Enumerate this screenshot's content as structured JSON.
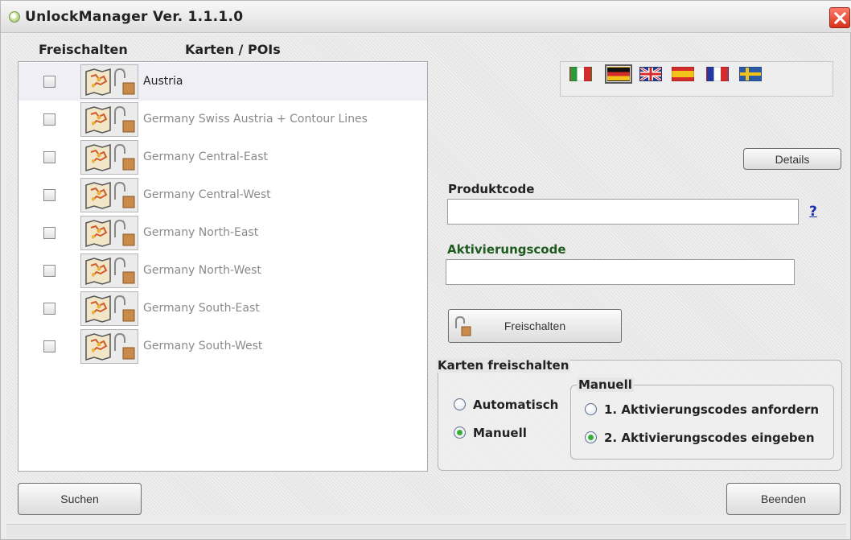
{
  "window": {
    "title": "UnlockManager Ver. 1.1.1.0"
  },
  "list": {
    "header_unlock": "Freischalten",
    "header_maps": "Karten / POIs",
    "items": [
      {
        "label": "Austria",
        "selected": true,
        "checked": false
      },
      {
        "label": "Germany Swiss Austria + Contour Lines",
        "selected": false,
        "checked": false
      },
      {
        "label": "Germany Central-East",
        "selected": false,
        "checked": false
      },
      {
        "label": "Germany Central-West",
        "selected": false,
        "checked": false
      },
      {
        "label": "Germany North-East",
        "selected": false,
        "checked": false
      },
      {
        "label": "Germany North-West",
        "selected": false,
        "checked": false
      },
      {
        "label": "Germany South-East",
        "selected": false,
        "checked": false
      },
      {
        "label": "Germany South-West",
        "selected": false,
        "checked": false
      }
    ],
    "item_icon": "map-lock-icon"
  },
  "languages": {
    "flags": [
      "it",
      "de",
      "gb",
      "es",
      "fr",
      "se"
    ],
    "selected": "de"
  },
  "details_button": "Details",
  "product_code": {
    "label": "Produktcode",
    "value": "",
    "help": "?"
  },
  "activation_code": {
    "label": "Aktivierungscode",
    "value": ""
  },
  "unlock_button": {
    "label": "Freischalten",
    "icon": "open-lock-icon"
  },
  "unlock_group": {
    "legend": "Karten freischalten",
    "automatic": "Automatisch",
    "manual": "Manuell",
    "selected": "manual",
    "manual_group": {
      "legend": "Manuell",
      "step1": "1. Aktivierungscodes anfordern",
      "step2": "2. Aktivierungscodes eingeben",
      "selected": "step2"
    }
  },
  "buttons": {
    "search": "Suchen",
    "exit": "Beenden"
  },
  "colors": {
    "radio_checked": "#35b035",
    "help_link": "#1a2fb0",
    "activation_label": "#1f5a1f",
    "close_button": "#d8321e"
  }
}
